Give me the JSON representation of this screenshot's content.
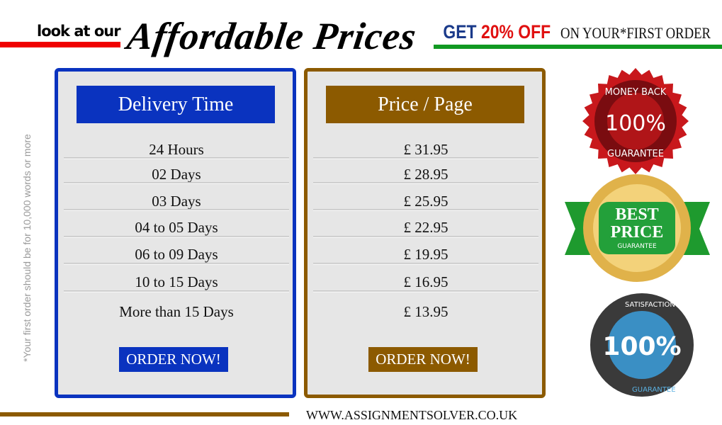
{
  "header": {
    "lead": "look at our",
    "title": "Affordable Prices",
    "offer_get": "GET ",
    "offer_pct": "20% OFF",
    "offer_rest": "ON YOUR*FIRST ORDER"
  },
  "delivery": {
    "title": "Delivery Time",
    "rows": [
      "24 Hours",
      "02 Days",
      "03 Days",
      "04 to 05 Days",
      "06 to 09 Days",
      "10 to 15 Days",
      "More than 15 Days"
    ],
    "button": "ORDER NOW!"
  },
  "price": {
    "title": "Price / Page",
    "rows": [
      "£ 31.95",
      "£ 28.95",
      "£ 25.95",
      "£ 22.95",
      "£ 19.95",
      "£ 16.95",
      "£ 13.95"
    ],
    "button": "ORDER NOW!"
  },
  "note": "*Your first order should be for 10,000 words or more",
  "footer": {
    "url": "WWW.ASSIGNMENTSOLVER.CO.UK"
  },
  "badges": {
    "money_back": [
      "MONEY BACK",
      "100%",
      "GUARANTEE"
    ],
    "best_price": [
      "BEST",
      "PRICE",
      "GUARANTEE"
    ],
    "satisfaction": [
      "SATISFACTION",
      "GUARANTEE",
      "100%"
    ]
  },
  "colors": {
    "blue": "#0a33bf",
    "brown": "#8c5a00",
    "red": "#f00000",
    "green": "#119922"
  }
}
